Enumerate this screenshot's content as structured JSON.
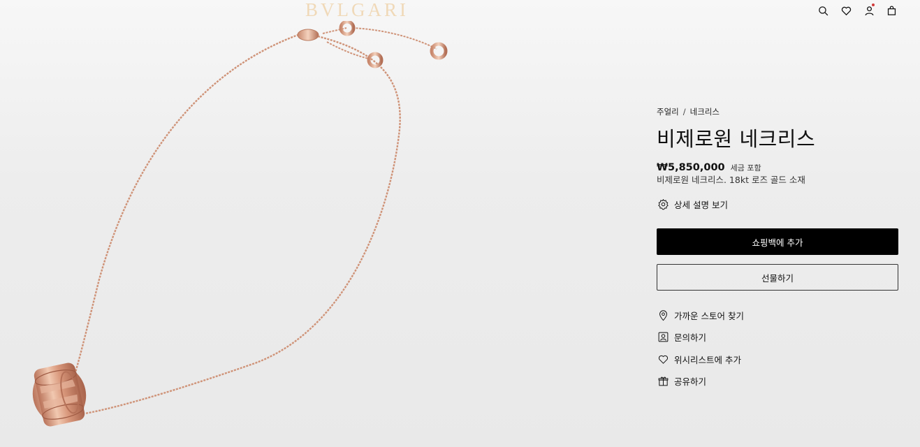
{
  "header": {
    "logo": "BVLGARI",
    "icons": [
      "search-icon",
      "heart-icon",
      "account-icon",
      "shopping-bag-icon"
    ]
  },
  "product": {
    "breadcrumb": [
      "주얼리",
      "네크리스"
    ],
    "breadcrumb_separator": "/",
    "title": "비제로원 네크리스",
    "price": "₩5,850,000",
    "tax_note": "세금 포함",
    "subtitle": "비제로원 네크리스. 18kt 로즈 골드 소재",
    "details_link": "상세 설명 보기",
    "add_to_bag": "쇼핑백에 추가",
    "gift": "선물하기",
    "actions": {
      "find_store": "가까운 스토어 찾기",
      "contact": "문의하기",
      "wishlist": "위시리스트에 추가",
      "share": "공유하기"
    }
  },
  "colors": {
    "rose_gold": "#d9a084",
    "button_black": "#000000",
    "background": "#ececec"
  }
}
